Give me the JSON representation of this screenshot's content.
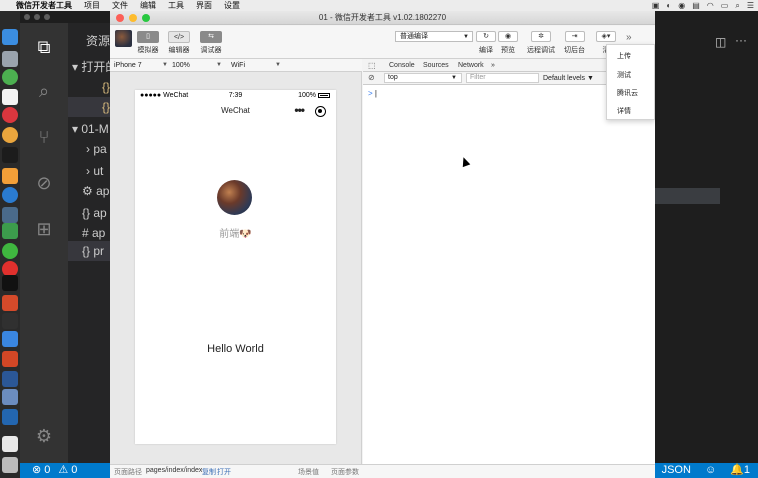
{
  "menubar": {
    "apple": "",
    "items": [
      "微信开发者工具",
      "项目",
      "文件",
      "编辑",
      "工具",
      "界面",
      "设置"
    ]
  },
  "window": {
    "title": "01 - 微信开发者工具 v1.02.1802270"
  },
  "toolbar": {
    "simulator": "模拟器",
    "editor": "编辑器",
    "debugger": "调试器",
    "compile_mode": "普通编译",
    "compile": "编译",
    "preview": "预览",
    "remote_debug": "远程调试",
    "switch_backend": "切后台",
    "clear": "清",
    "more": "»"
  },
  "devicebar": {
    "device": "iPhone 7",
    "zoom": "100%",
    "network": "WiFi"
  },
  "phone": {
    "carrier": "●●●●● WeChat",
    "time": "7:39",
    "battery": "100%",
    "nav_title": "WeChat",
    "nav_dots": "•••",
    "nickname": "前端🐶",
    "hello": "Hello World"
  },
  "pathbar": {
    "label": "页面路径",
    "path": "pages/index/index",
    "copy": "复制",
    "open": "打开",
    "scene": "场景值",
    "params": "页面参数"
  },
  "devtools": {
    "tabs": [
      "Console",
      "Sources",
      "Network",
      "»"
    ],
    "context": "top",
    "filter_placeholder": "Filter",
    "levels": "Default levels ▼",
    "prompt": ">"
  },
  "popup_menu": {
    "items": [
      "上传",
      "测试",
      "腾讯云",
      "详情"
    ]
  },
  "vscode": {
    "sidebar_rows": [
      "资源管",
      "▾ 打开的",
      "{}",
      "{}",
      "▾ 01-M",
      "› pa",
      "› ut",
      "⚙ ap",
      "{} ap",
      "# ap",
      "{} pr"
    ],
    "status_errors": "⊗ 0",
    "status_warnings": "⚠ 0",
    "status_lang": "JSON",
    "status_smile": "☺",
    "status_bell": "🔔1"
  }
}
